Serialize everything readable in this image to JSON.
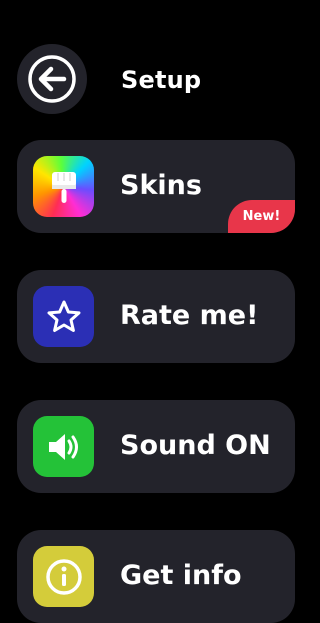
{
  "header": {
    "title": "Setup"
  },
  "menu": {
    "items": [
      {
        "label": "Skins",
        "icon": "paint-brush-icon",
        "badge": "New!",
        "icon_color": "rainbow-gradient"
      },
      {
        "label": "Rate me!",
        "icon": "star-icon",
        "icon_color": "#2b2fb5"
      },
      {
        "label": "Sound ON",
        "icon": "speaker-icon",
        "icon_color": "#24c238"
      },
      {
        "label": "Get info",
        "icon": "info-icon",
        "icon_color": "#d4cc3a"
      }
    ]
  },
  "colors": {
    "background": "#000000",
    "card": "#23232b",
    "badge": "#e8364a",
    "text": "#ffffff"
  }
}
